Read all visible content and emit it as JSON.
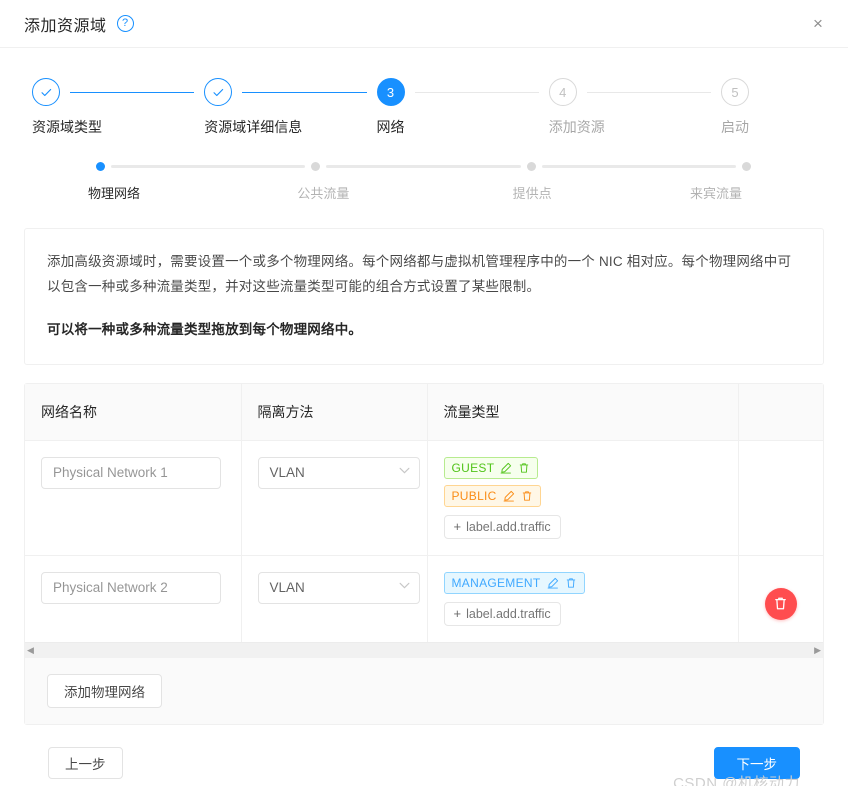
{
  "header": {
    "title": "添加资源域",
    "help_icon": "question-circle-icon",
    "close_icon": "×"
  },
  "steps": [
    {
      "label": "资源域类型",
      "state": "done",
      "num": "1",
      "icon": "check-icon"
    },
    {
      "label": "资源域详细信息",
      "state": "done",
      "num": "2",
      "icon": "check-icon"
    },
    {
      "label": "网络",
      "state": "active",
      "num": "3",
      "icon": ""
    },
    {
      "label": "添加资源",
      "state": "wait",
      "num": "4",
      "icon": ""
    },
    {
      "label": "启动",
      "state": "wait",
      "num": "5",
      "icon": ""
    }
  ],
  "substeps": [
    {
      "label": "物理网络",
      "state": "active"
    },
    {
      "label": "公共流量",
      "state": "wait"
    },
    {
      "label": "提供点",
      "state": "wait"
    },
    {
      "label": "来宾流量",
      "state": "wait"
    }
  ],
  "info": {
    "paragraph": "添加高级资源域时，需要设置一个或多个物理网络。每个网络都与虚拟机管理程序中的一个 NIC 相对应。每个物理网络中可以包含一种或多种流量类型，并对这些流量类型可能的组合方式设置了某些限制。",
    "bold_note": "可以将一种或多种流量类型拖放到每个物理网络中。"
  },
  "table": {
    "columns": [
      {
        "label": "网络名称"
      },
      {
        "label": "隔离方法"
      },
      {
        "label": "流量类型"
      },
      {
        "label": ""
      }
    ],
    "rows": [
      {
        "name_placeholder": "Physical Network 1",
        "name_value": "",
        "isolation": "VLAN",
        "tags": [
          {
            "label": "GUEST",
            "color": "green",
            "edit_icon": "pencil-icon",
            "delete_icon": "trash-icon"
          },
          {
            "label": "PUBLIC",
            "color": "orange",
            "edit_icon": "pencil-icon",
            "delete_icon": "trash-icon"
          }
        ],
        "add_traffic_label": "label.add.traffic",
        "has_delete": false
      },
      {
        "name_placeholder": "Physical Network 2",
        "name_value": "",
        "isolation": "VLAN",
        "tags": [
          {
            "label": "MANAGEMENT",
            "color": "blue",
            "edit_icon": "pencil-icon",
            "delete_icon": "trash-icon"
          }
        ],
        "add_traffic_label": "label.add.traffic",
        "has_delete": true
      }
    ],
    "add_network_label": "添加物理网络",
    "scroll_left_icon": "◀",
    "scroll_right_icon": "▶"
  },
  "footer": {
    "prev_label": "上一步",
    "next_label": "下一步",
    "watermark": "CSDN @机核动力"
  },
  "colors": {
    "primary": "#1890ff",
    "danger": "#ff4d4f",
    "tag_green": "#52c41a",
    "tag_orange": "#fa8c16",
    "tag_blue": "#40a9ff"
  }
}
